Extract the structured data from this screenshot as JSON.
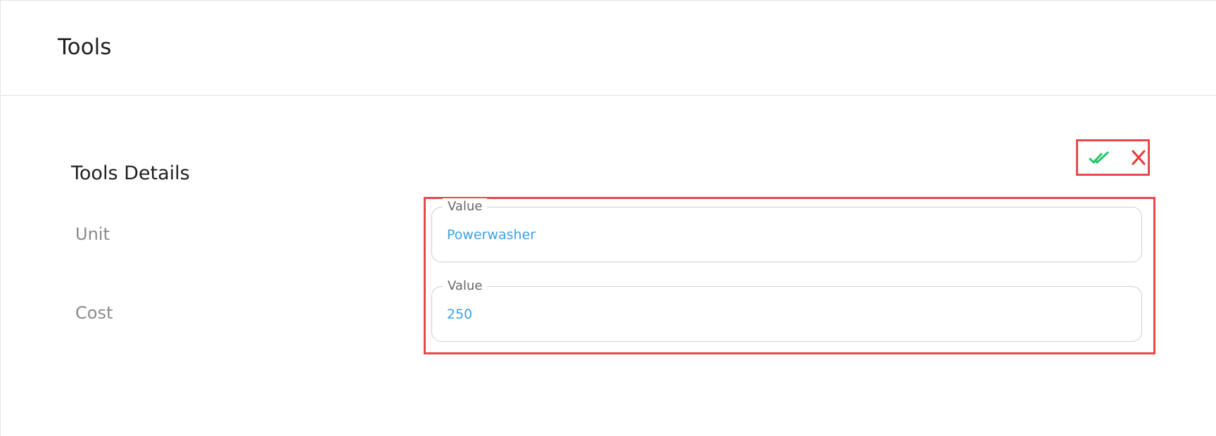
{
  "header": {
    "title": "Tools"
  },
  "details": {
    "title": "Tools Details",
    "actions": {
      "confirm_icon": "double-check-icon",
      "cancel_icon": "close-icon"
    },
    "fields": [
      {
        "label": "Unit",
        "legend": "Value",
        "value": "Powerwasher"
      },
      {
        "label": "Cost",
        "legend": "Value",
        "value": "250"
      }
    ]
  },
  "colors": {
    "confirm": "#25c46a",
    "cancel": "#e53935",
    "highlight": "#e8474c",
    "value_text": "#3ea0df"
  }
}
